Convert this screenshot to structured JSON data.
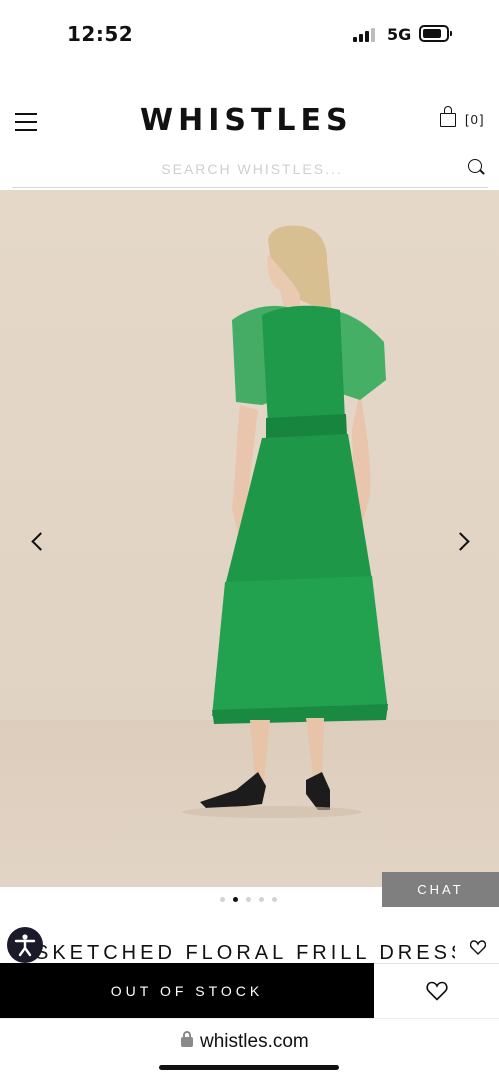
{
  "status_bar": {
    "time": "12:52",
    "network": "5G"
  },
  "header": {
    "logo": "WHISTLES",
    "bag_count": "[0]"
  },
  "search": {
    "placeholder": "SEARCH WHISTLES..."
  },
  "gallery": {
    "image_description_icon": "product-photo",
    "slide_count": 5,
    "active_slide": 2,
    "colors": {
      "dress": "#1f9a4a",
      "background": "#e4d7c8"
    }
  },
  "chat": {
    "label": "CHAT"
  },
  "product": {
    "title": "SKETCHED FLORAL FRILL DRESS"
  },
  "actions": {
    "out_of_stock_label": "OUT OF STOCK"
  },
  "browser": {
    "url": "whistles.com"
  }
}
